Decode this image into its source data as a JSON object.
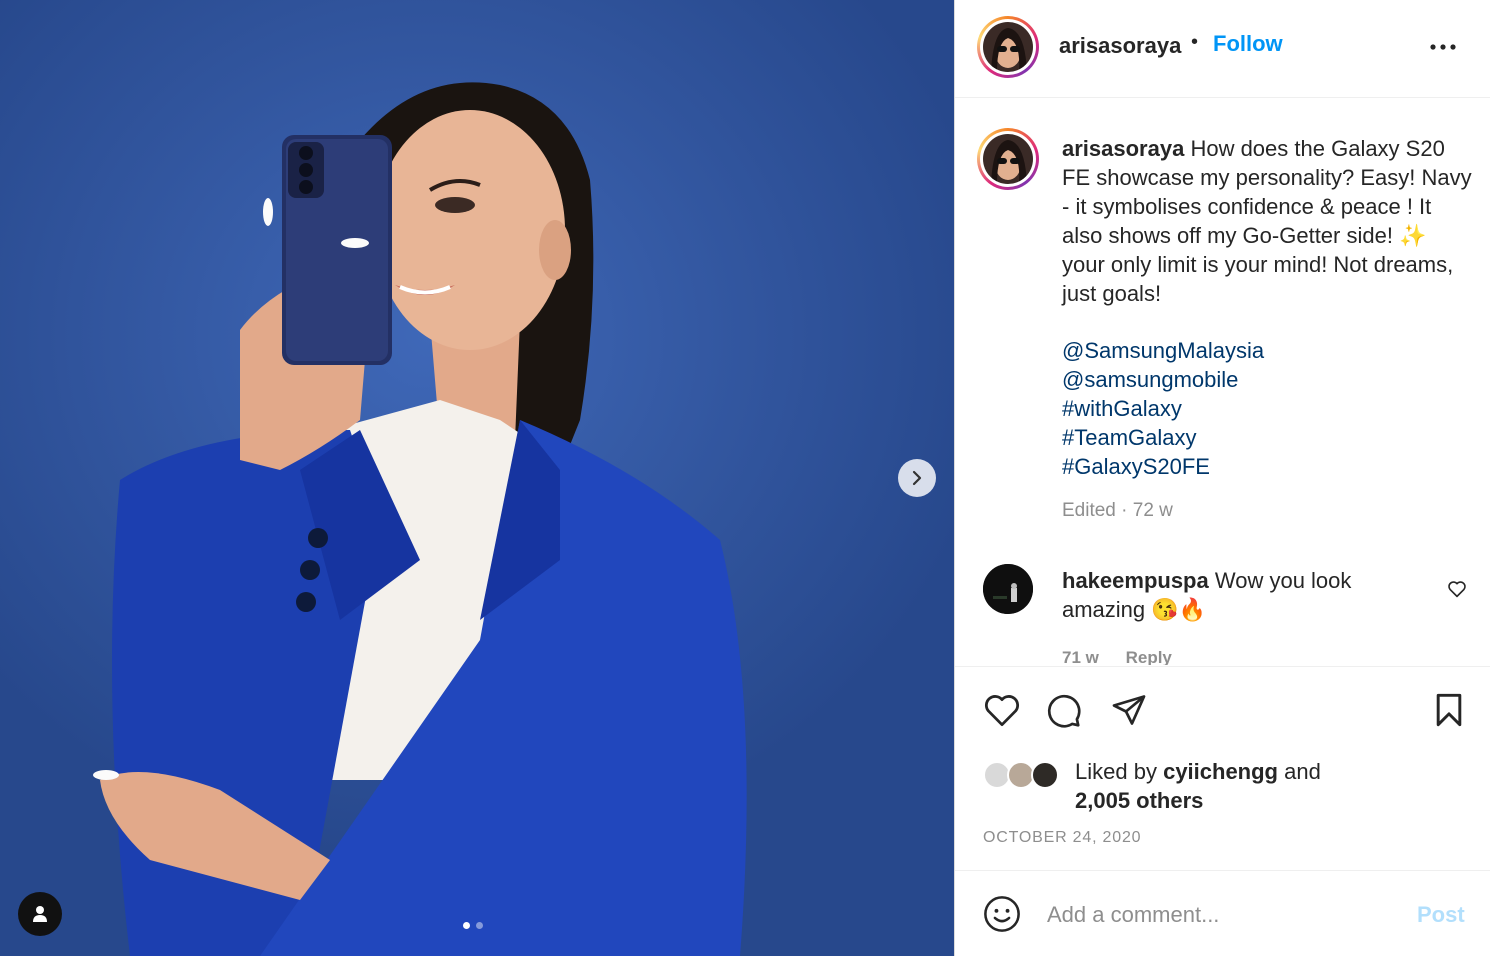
{
  "post": {
    "author": "arisasoraya",
    "follow_label": "Follow",
    "separator": "•",
    "more_icon": "more-horizontal-icon",
    "image_slide": {
      "current": 1,
      "total": 2
    },
    "caption": {
      "username": "arisasoraya",
      "text": "How does the Galaxy S20 FE showcase my personality? Easy! Navy - it symbolises confidence & peace ! It also shows off my Go-Getter side! ✨ your only limit is your mind! Not dreams, just goals!",
      "tags": [
        "@SamsungMalaysia",
        "@samsungmobile",
        "#withGalaxy",
        "#TeamGalaxy",
        "#GalaxyS20FE"
      ],
      "meta": "Edited · 72 w"
    },
    "comments": [
      {
        "username": "hakeempuspa",
        "text": "Wow you look amazing 😘🔥",
        "time": "71 w",
        "reply_label": "Reply"
      }
    ],
    "likes": {
      "prefix": "Liked by",
      "user": "cyiichengg",
      "and": "and",
      "others": "2,005 others"
    },
    "date": "OCTOBER 24, 2020",
    "comment_input": {
      "placeholder": "Add a comment...",
      "value": ""
    },
    "post_label": "Post",
    "colors": {
      "link": "#0095f6",
      "hashtag": "#00376b",
      "muted": "#8e8e8e",
      "post_disabled": "#b2dffc"
    }
  }
}
